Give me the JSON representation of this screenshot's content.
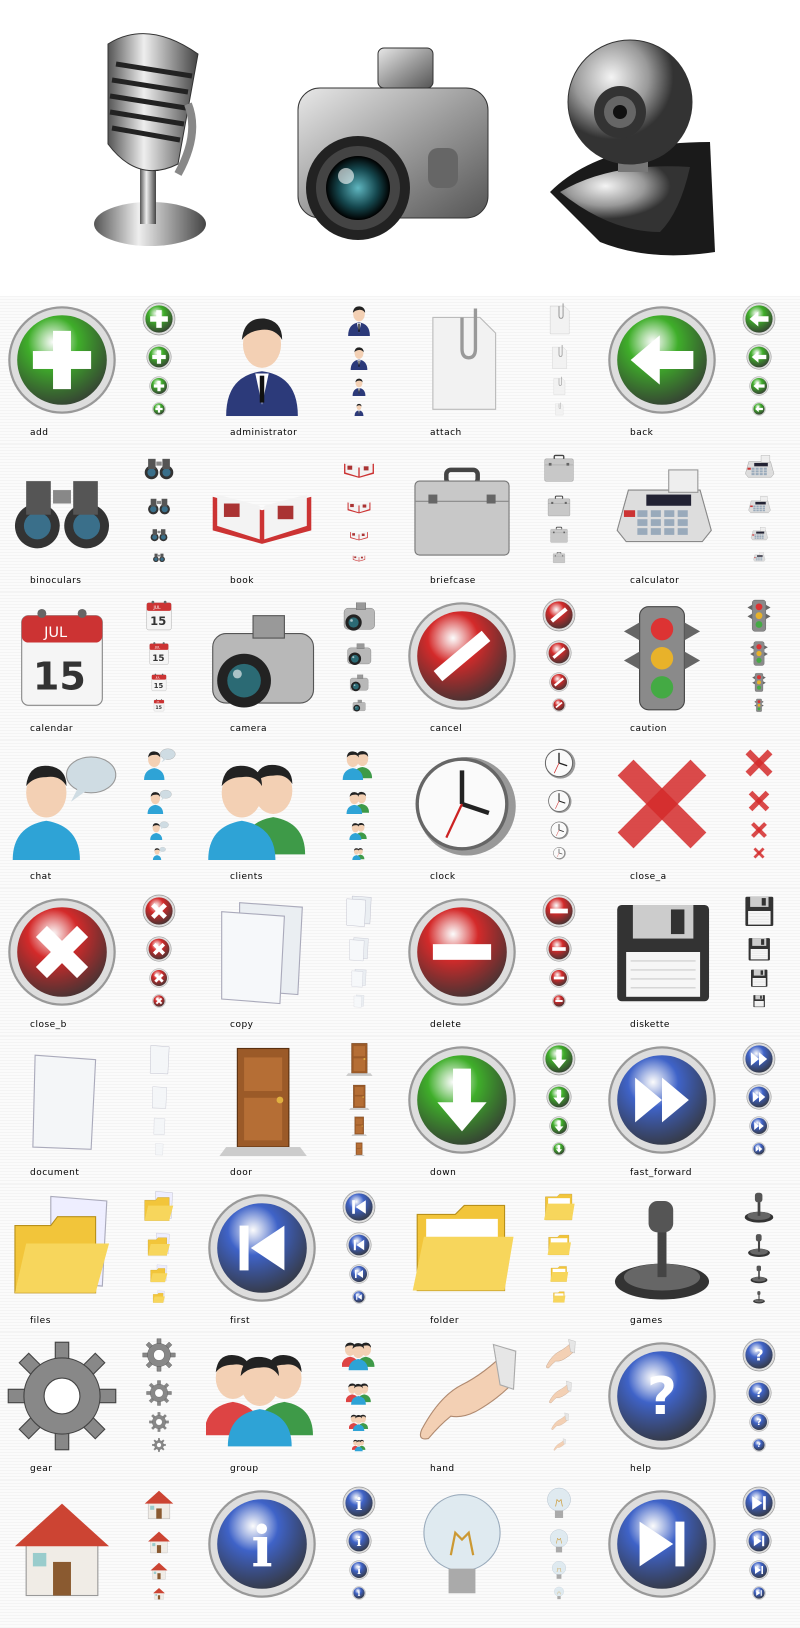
{
  "gallery": {
    "hero_icons": [
      "microphone-icon",
      "camera-icon",
      "webcam-icon"
    ],
    "items": [
      {
        "label": "add",
        "icon": "add-icon"
      },
      {
        "label": "administrator",
        "icon": "administrator-icon"
      },
      {
        "label": "attach",
        "icon": "attach-icon"
      },
      {
        "label": "back",
        "icon": "back-icon"
      },
      {
        "label": "binoculars",
        "icon": "binoculars-icon"
      },
      {
        "label": "book",
        "icon": "book-icon"
      },
      {
        "label": "briefcase",
        "icon": "briefcase-icon"
      },
      {
        "label": "calculator",
        "icon": "calculator-icon"
      },
      {
        "label": "calendar",
        "icon": "calendar-icon"
      },
      {
        "label": "camera",
        "icon": "camera-icon"
      },
      {
        "label": "cancel",
        "icon": "cancel-icon"
      },
      {
        "label": "caution",
        "icon": "caution-icon"
      },
      {
        "label": "chat",
        "icon": "chat-icon"
      },
      {
        "label": "clients",
        "icon": "clients-icon"
      },
      {
        "label": "clock",
        "icon": "clock-icon"
      },
      {
        "label": "close_a",
        "icon": "close-a-icon"
      },
      {
        "label": "close_b",
        "icon": "close-b-icon"
      },
      {
        "label": "copy",
        "icon": "copy-icon"
      },
      {
        "label": "delete",
        "icon": "delete-icon"
      },
      {
        "label": "diskette",
        "icon": "diskette-icon"
      },
      {
        "label": "document",
        "icon": "document-icon"
      },
      {
        "label": "door",
        "icon": "door-icon"
      },
      {
        "label": "down",
        "icon": "down-icon"
      },
      {
        "label": "fast_forward",
        "icon": "fast-forward-icon"
      },
      {
        "label": "files",
        "icon": "files-icon"
      },
      {
        "label": "first",
        "icon": "first-icon"
      },
      {
        "label": "folder",
        "icon": "folder-icon"
      },
      {
        "label": "games",
        "icon": "games-icon"
      },
      {
        "label": "gear",
        "icon": "gear-icon"
      },
      {
        "label": "group",
        "icon": "group-icon"
      },
      {
        "label": "hand",
        "icon": "hand-icon"
      },
      {
        "label": "help",
        "icon": "help-icon"
      },
      {
        "label": "",
        "icon": "home-icon"
      },
      {
        "label": "",
        "icon": "info-icon"
      },
      {
        "label": "",
        "icon": "lightbulb-icon"
      },
      {
        "label": "",
        "icon": "next-icon"
      }
    ],
    "colors": {
      "green": "#3fae2a",
      "red": "#d42a2a",
      "blue": "#3f63c8",
      "silver": "#9aa0a6",
      "folder": "#f2c53a",
      "skin": "#f3d0b4"
    }
  }
}
